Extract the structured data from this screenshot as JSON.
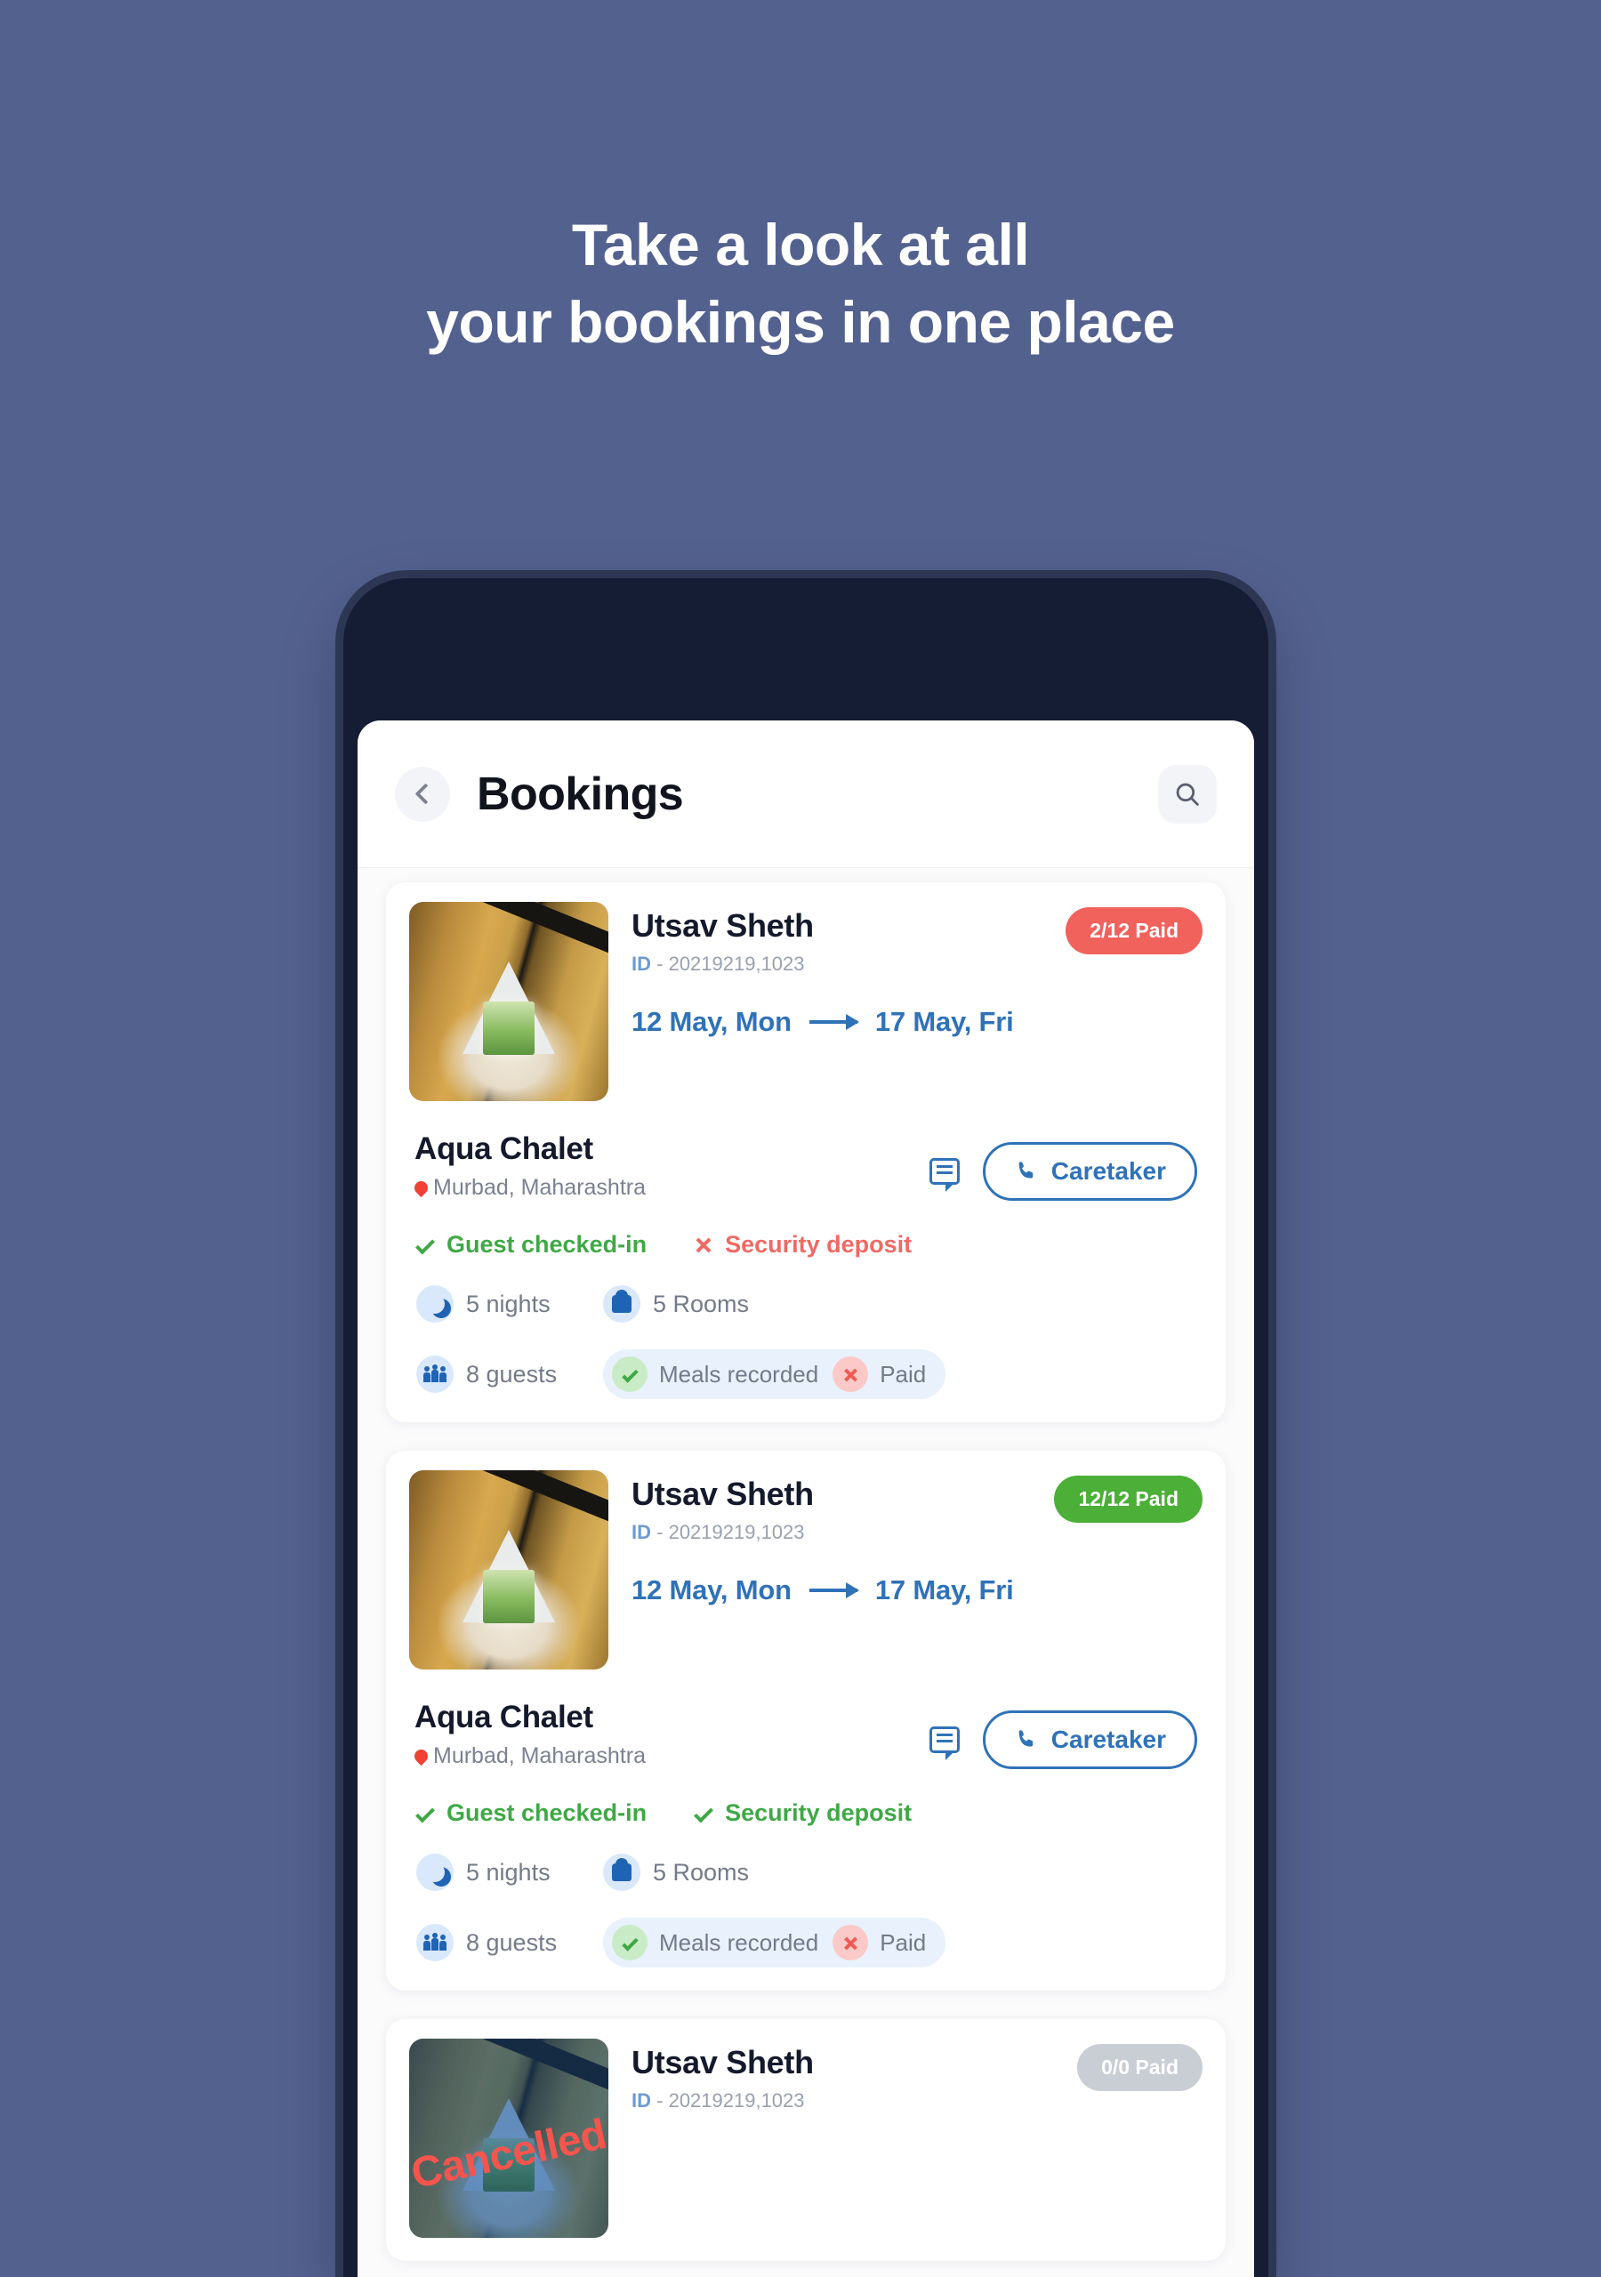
{
  "promo": {
    "line1": "Take a look at all",
    "line2": "your bookings in one place"
  },
  "appbar": {
    "back_icon": "chevron-left-icon",
    "title": "Bookings",
    "search_icon": "search-icon"
  },
  "labels": {
    "caretaker": "Caretaker",
    "chat_icon": "chat-icon",
    "phone_icon": "phone-icon",
    "arrow_icon": "arrow-right-icon",
    "pin_icon": "location-pin-icon"
  },
  "colors": {
    "background": "#53618f",
    "phone_frame": "#151d35",
    "accent_blue": "#2f72b8",
    "paid_red": "#f1625d",
    "paid_green": "#4caf37",
    "paid_gray": "#c9cdd4",
    "status_ok": "#3fa845",
    "status_no": "#ef6a64"
  },
  "bookings": [
    {
      "guest_name": "Utsav Sheth",
      "id_label": "ID",
      "id_sep": "-",
      "id_value": "20219219,1023",
      "payment_badge": "2/12 Paid",
      "payment_state": "red",
      "check_in": "12 May, Mon",
      "check_out": "17 May, Fri",
      "property": "Aqua Chalet",
      "location": "Murbad, Maharashtra",
      "caretaker": "Caretaker",
      "checkin_status": "Guest checked-in",
      "checkin_ok": true,
      "deposit_status": "Security deposit",
      "deposit_ok": false,
      "nights": "5 nights",
      "rooms": "5 Rooms",
      "guests": "8 guests",
      "meals": "Meals recorded",
      "meals_ok": true,
      "paid": "Paid",
      "paid_ok": false,
      "cancelled": false
    },
    {
      "guest_name": "Utsav Sheth",
      "id_label": "ID",
      "id_sep": "-",
      "id_value": "20219219,1023",
      "payment_badge": "12/12 Paid",
      "payment_state": "green",
      "check_in": "12 May, Mon",
      "check_out": "17 May, Fri",
      "property": "Aqua Chalet",
      "location": "Murbad, Maharashtra",
      "caretaker": "Caretaker",
      "checkin_status": "Guest checked-in",
      "checkin_ok": true,
      "deposit_status": "Security deposit",
      "deposit_ok": true,
      "nights": "5 nights",
      "rooms": "5 Rooms",
      "guests": "8 guests",
      "meals": "Meals recorded",
      "meals_ok": true,
      "paid": "Paid",
      "paid_ok": false,
      "cancelled": false
    },
    {
      "guest_name": "Utsav Sheth",
      "id_label": "ID",
      "id_sep": "-",
      "id_value": "20219219,1023",
      "payment_badge": "0/0 Paid",
      "payment_state": "gray",
      "cancelled": true,
      "cancelled_text": "Cancelled"
    }
  ]
}
